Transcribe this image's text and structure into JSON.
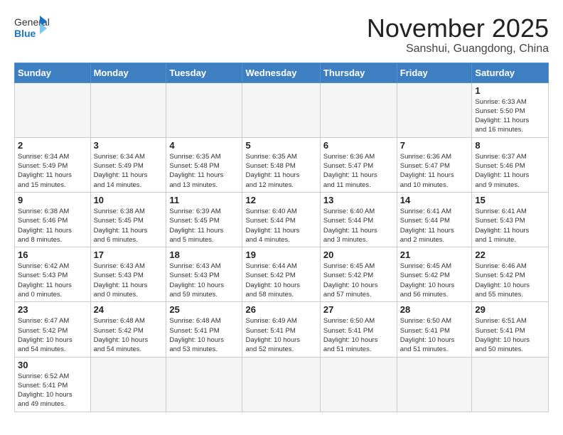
{
  "logo": {
    "text_general": "General",
    "text_blue": "Blue"
  },
  "title": {
    "month_year": "November 2025",
    "location": "Sanshui, Guangdong, China"
  },
  "days_of_week": [
    "Sunday",
    "Monday",
    "Tuesday",
    "Wednesday",
    "Thursday",
    "Friday",
    "Saturday"
  ],
  "weeks": [
    [
      {
        "day": null,
        "info": null
      },
      {
        "day": null,
        "info": null
      },
      {
        "day": null,
        "info": null
      },
      {
        "day": null,
        "info": null
      },
      {
        "day": null,
        "info": null
      },
      {
        "day": null,
        "info": null
      },
      {
        "day": "1",
        "info": "Sunrise: 6:33 AM\nSunset: 5:50 PM\nDaylight: 11 hours\nand 16 minutes."
      }
    ],
    [
      {
        "day": "2",
        "info": "Sunrise: 6:34 AM\nSunset: 5:49 PM\nDaylight: 11 hours\nand 15 minutes."
      },
      {
        "day": "3",
        "info": "Sunrise: 6:34 AM\nSunset: 5:49 PM\nDaylight: 11 hours\nand 14 minutes."
      },
      {
        "day": "4",
        "info": "Sunrise: 6:35 AM\nSunset: 5:48 PM\nDaylight: 11 hours\nand 13 minutes."
      },
      {
        "day": "5",
        "info": "Sunrise: 6:35 AM\nSunset: 5:48 PM\nDaylight: 11 hours\nand 12 minutes."
      },
      {
        "day": "6",
        "info": "Sunrise: 6:36 AM\nSunset: 5:47 PM\nDaylight: 11 hours\nand 11 minutes."
      },
      {
        "day": "7",
        "info": "Sunrise: 6:36 AM\nSunset: 5:47 PM\nDaylight: 11 hours\nand 10 minutes."
      },
      {
        "day": "8",
        "info": "Sunrise: 6:37 AM\nSunset: 5:46 PM\nDaylight: 11 hours\nand 9 minutes."
      }
    ],
    [
      {
        "day": "9",
        "info": "Sunrise: 6:38 AM\nSunset: 5:46 PM\nDaylight: 11 hours\nand 8 minutes."
      },
      {
        "day": "10",
        "info": "Sunrise: 6:38 AM\nSunset: 5:45 PM\nDaylight: 11 hours\nand 6 minutes."
      },
      {
        "day": "11",
        "info": "Sunrise: 6:39 AM\nSunset: 5:45 PM\nDaylight: 11 hours\nand 5 minutes."
      },
      {
        "day": "12",
        "info": "Sunrise: 6:40 AM\nSunset: 5:44 PM\nDaylight: 11 hours\nand 4 minutes."
      },
      {
        "day": "13",
        "info": "Sunrise: 6:40 AM\nSunset: 5:44 PM\nDaylight: 11 hours\nand 3 minutes."
      },
      {
        "day": "14",
        "info": "Sunrise: 6:41 AM\nSunset: 5:44 PM\nDaylight: 11 hours\nand 2 minutes."
      },
      {
        "day": "15",
        "info": "Sunrise: 6:41 AM\nSunset: 5:43 PM\nDaylight: 11 hours\nand 1 minute."
      }
    ],
    [
      {
        "day": "16",
        "info": "Sunrise: 6:42 AM\nSunset: 5:43 PM\nDaylight: 11 hours\nand 0 minutes."
      },
      {
        "day": "17",
        "info": "Sunrise: 6:43 AM\nSunset: 5:43 PM\nDaylight: 11 hours\nand 0 minutes."
      },
      {
        "day": "18",
        "info": "Sunrise: 6:43 AM\nSunset: 5:43 PM\nDaylight: 10 hours\nand 59 minutes."
      },
      {
        "day": "19",
        "info": "Sunrise: 6:44 AM\nSunset: 5:42 PM\nDaylight: 10 hours\nand 58 minutes."
      },
      {
        "day": "20",
        "info": "Sunrise: 6:45 AM\nSunset: 5:42 PM\nDaylight: 10 hours\nand 57 minutes."
      },
      {
        "day": "21",
        "info": "Sunrise: 6:45 AM\nSunset: 5:42 PM\nDaylight: 10 hours\nand 56 minutes."
      },
      {
        "day": "22",
        "info": "Sunrise: 6:46 AM\nSunset: 5:42 PM\nDaylight: 10 hours\nand 55 minutes."
      }
    ],
    [
      {
        "day": "23",
        "info": "Sunrise: 6:47 AM\nSunset: 5:42 PM\nDaylight: 10 hours\nand 54 minutes."
      },
      {
        "day": "24",
        "info": "Sunrise: 6:48 AM\nSunset: 5:42 PM\nDaylight: 10 hours\nand 54 minutes."
      },
      {
        "day": "25",
        "info": "Sunrise: 6:48 AM\nSunset: 5:41 PM\nDaylight: 10 hours\nand 53 minutes."
      },
      {
        "day": "26",
        "info": "Sunrise: 6:49 AM\nSunset: 5:41 PM\nDaylight: 10 hours\nand 52 minutes."
      },
      {
        "day": "27",
        "info": "Sunrise: 6:50 AM\nSunset: 5:41 PM\nDaylight: 10 hours\nand 51 minutes."
      },
      {
        "day": "28",
        "info": "Sunrise: 6:50 AM\nSunset: 5:41 PM\nDaylight: 10 hours\nand 51 minutes."
      },
      {
        "day": "29",
        "info": "Sunrise: 6:51 AM\nSunset: 5:41 PM\nDaylight: 10 hours\nand 50 minutes."
      }
    ],
    [
      {
        "day": "30",
        "info": "Sunrise: 6:52 AM\nSunset: 5:41 PM\nDaylight: 10 hours\nand 49 minutes."
      },
      {
        "day": null,
        "info": null
      },
      {
        "day": null,
        "info": null
      },
      {
        "day": null,
        "info": null
      },
      {
        "day": null,
        "info": null
      },
      {
        "day": null,
        "info": null
      },
      {
        "day": null,
        "info": null
      }
    ]
  ]
}
